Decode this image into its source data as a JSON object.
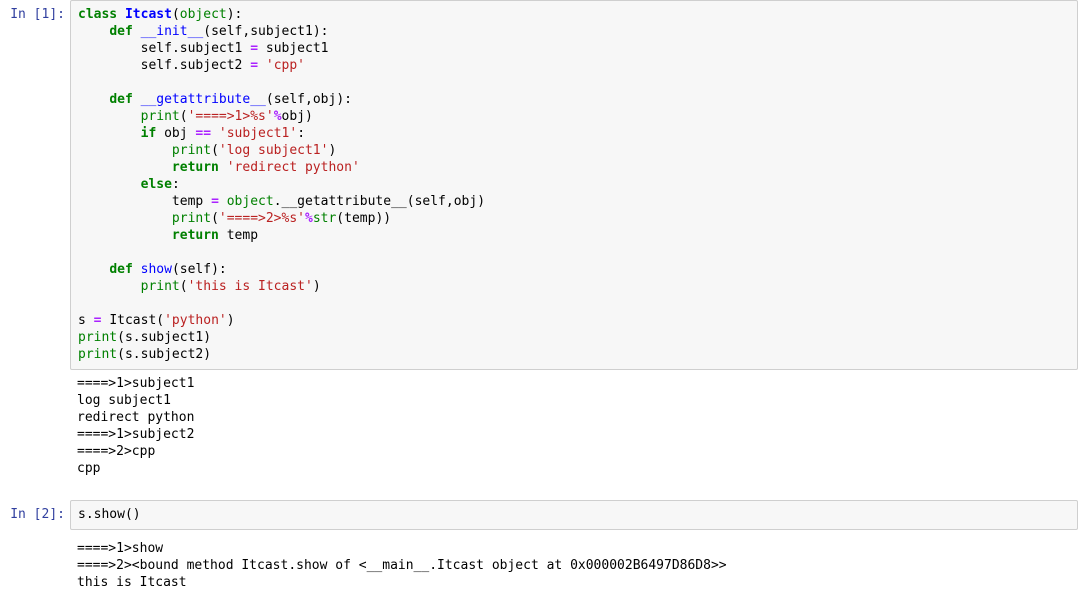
{
  "notebook": {
    "cells": [
      {
        "type": "code",
        "prompt": "In [1]:",
        "source": "class Itcast(object):\n    def __init__(self,subject1):\n        self.subject1 = subject1\n        self.subject2 = 'cpp'\n\n    def __getattribute__(self,obj):\n        print('====>1>%s'%obj)\n        if obj == 'subject1':\n            print('log subject1')\n            return 'redirect python'\n        else:\n            temp = object.__getattribute__(self,obj)\n            print('====>2>%s'%str(temp))\n            return temp\n\n    def show(self):\n        print('this is Itcast')\n\ns = Itcast('python')\nprint(s.subject1)\nprint(s.subject2)",
        "output": "====>1>subject1\nlog subject1\nredirect python\n====>1>subject2\n====>2>cpp\ncpp"
      },
      {
        "type": "code",
        "prompt": "In [2]:",
        "source": "s.show()",
        "output": "====>1>show\n====>2><bound method Itcast.show of <__main__.Itcast object at 0x000002B6497D86D8>>\nthis is Itcast"
      }
    ]
  },
  "colors": {
    "prompt": "#303F9F",
    "cell_background": "#f7f7f7",
    "cell_border": "#cfcfcf",
    "keyword": "#008000",
    "string": "#ba2121",
    "operator": "#aa22ff",
    "page_background": "#ffffff"
  }
}
